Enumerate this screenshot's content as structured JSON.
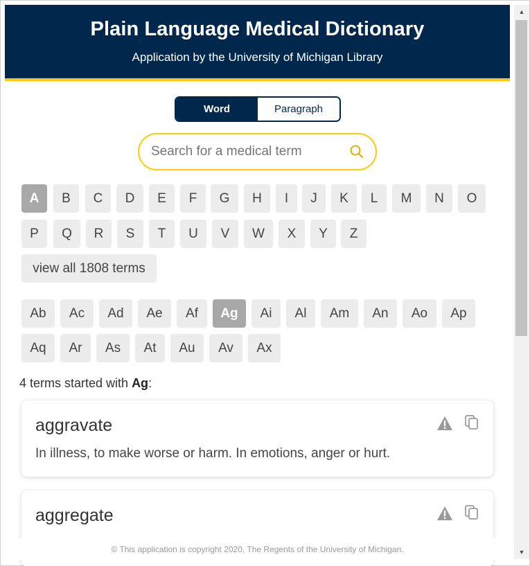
{
  "header": {
    "title": "Plain Language Medical Dictionary",
    "subtitle": "Application by the University of Michigan Library"
  },
  "mode": {
    "word": "Word",
    "paragraph": "Paragraph",
    "selected": "Word"
  },
  "search": {
    "placeholder": "Search for a medical term",
    "value": ""
  },
  "letters": [
    "A",
    "B",
    "C",
    "D",
    "E",
    "F",
    "G",
    "H",
    "I",
    "J",
    "K",
    "L",
    "M",
    "N",
    "O",
    "P",
    "Q",
    "R",
    "S",
    "T",
    "U",
    "V",
    "W",
    "X",
    "Y",
    "Z"
  ],
  "selected_letter": "A",
  "view_all_label": "view all 1808 terms",
  "subgroups": [
    "Ab",
    "Ac",
    "Ad",
    "Ae",
    "Af",
    "Ag",
    "Ai",
    "Al",
    "Am",
    "An",
    "Ao",
    "Ap",
    "Aq",
    "Ar",
    "As",
    "At",
    "Au",
    "Av",
    "Ax"
  ],
  "selected_subgroup": "Ag",
  "results": {
    "prefix": "4 terms started with ",
    "prefix_bold": "Ag",
    "suffix": ":"
  },
  "terms": [
    {
      "term": "aggravate",
      "definition": "In illness, to make worse or harm. In emotions, anger or hurt."
    },
    {
      "term": "aggregate",
      "definition": ""
    }
  ],
  "footer": "© This application is copyright 2020, The Regents of the University of Michigan.",
  "colors": {
    "navy": "#00274c",
    "maize": "#ffcb05",
    "button_bg": "#ececec",
    "selected_bg": "#a8a8a8"
  }
}
